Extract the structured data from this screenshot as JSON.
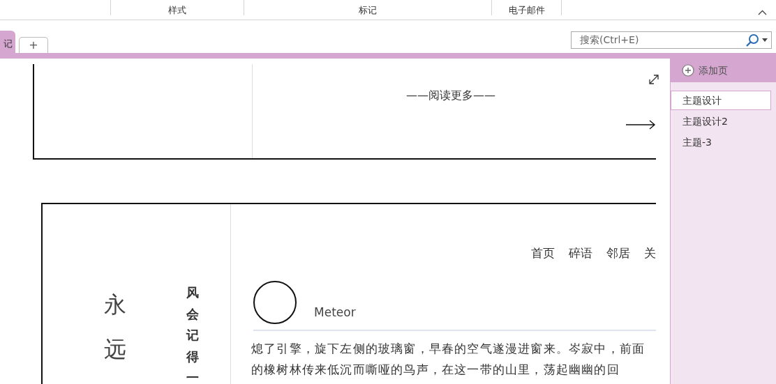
{
  "ribbon": {
    "groups": [
      "样式",
      "标记",
      "电子邮件"
    ]
  },
  "notebook_tabs": [
    {
      "label": "记",
      "selected": true
    }
  ],
  "add_tab": "+",
  "search": {
    "placeholder": "搜索(Ctrl+E)"
  },
  "top_card": {
    "read_more": "——阅读更多——"
  },
  "blog_card": {
    "title": "永远",
    "subtitle": "风会记得一",
    "nav": [
      "首页",
      "碎语",
      "邻居",
      "关"
    ],
    "author": "Meteor",
    "body": "熄了引擎，旋下左侧的玻璃窗，早春的空气遂漫进窗来。岑寂中，前面的橡树林传来低沉而嘶哑的鸟声，在这一带的山里，荡起幽幽的回"
  },
  "pages_panel": {
    "add_page": "添加页",
    "pages": [
      {
        "title": "主题设计",
        "selected": true
      },
      {
        "title": "主题设计2",
        "selected": false
      },
      {
        "title": "主题-3",
        "selected": false
      }
    ]
  }
}
